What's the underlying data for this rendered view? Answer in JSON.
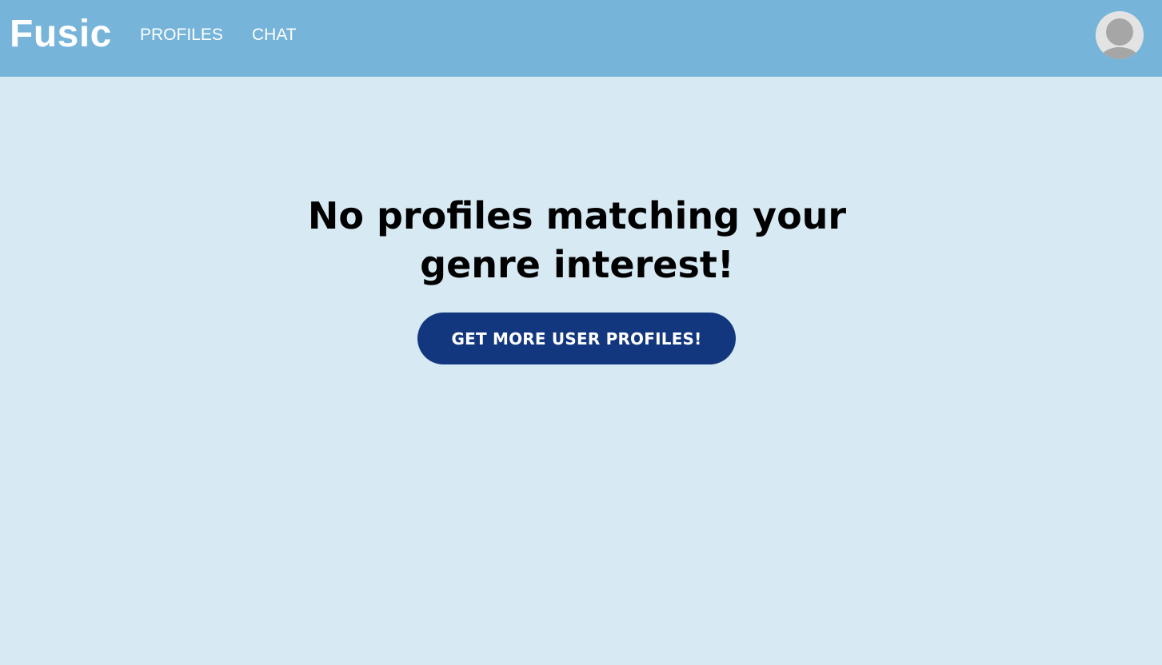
{
  "header": {
    "brand": "Fusic",
    "nav": {
      "profiles": "PROFILES",
      "chat": "CHAT"
    },
    "avatar_icon": "user-avatar-icon",
    "background_color": "#76b4da"
  },
  "main": {
    "headline_line1": "No profiles matching your",
    "headline_line2": "genre interest!",
    "cta_label": "GET MORE USER PROFILES!",
    "background_color": "#d7e9f3",
    "cta_color": "#13377e"
  }
}
